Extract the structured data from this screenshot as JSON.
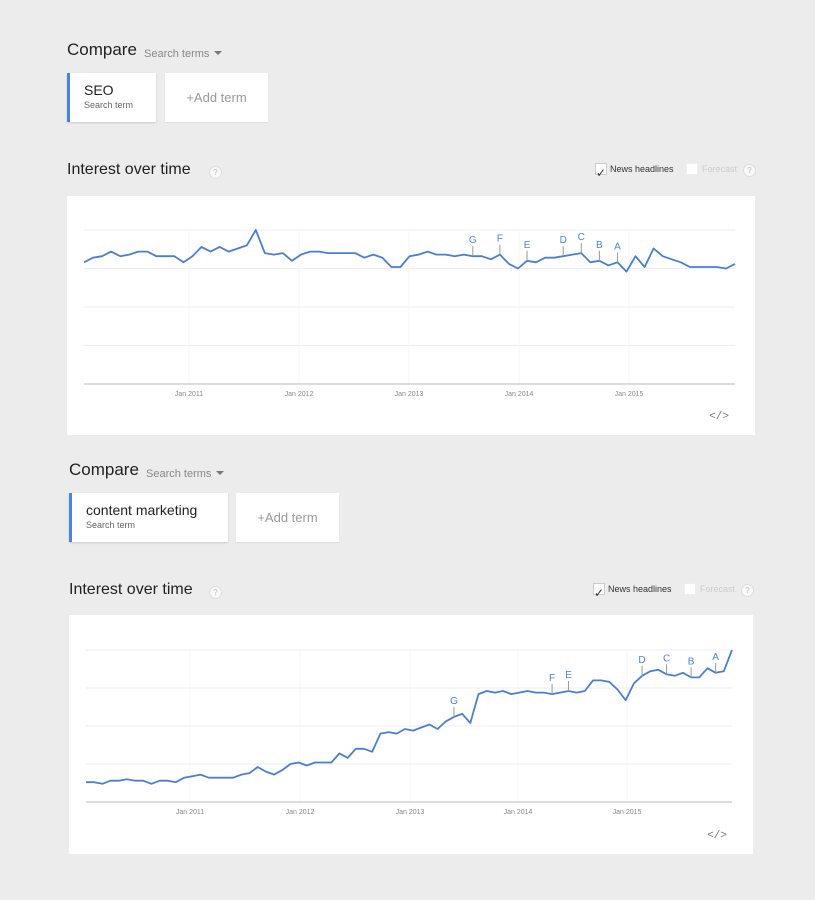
{
  "sections": [
    {
      "compare": {
        "title": "Compare",
        "mode": "Search terms"
      },
      "term": {
        "name": "SEO",
        "type": "Search term"
      },
      "add_term": "+Add term",
      "interest": {
        "title": "Interest over time",
        "help": "?"
      },
      "options": {
        "news_headlines": "News headlines",
        "news_checked": true,
        "forecast": "Forecast",
        "forecast_checked": false
      },
      "embed_icon": "</>"
    },
    {
      "compare": {
        "title": "Compare",
        "mode": "Search terms"
      },
      "term": {
        "name": "content marketing",
        "type": "Search term"
      },
      "add_term": "+Add term",
      "interest": {
        "title": "Interest over time",
        "help": "?"
      },
      "options": {
        "news_headlines": "News headlines",
        "news_checked": true,
        "forecast": "Forecast",
        "forecast_checked": false
      },
      "embed_icon": "</>"
    }
  ],
  "colors": {
    "line": "#4a7fd0",
    "accent": "#4a86d8",
    "grid": "#eeeeee",
    "axis": "#bbbbbb"
  },
  "chart_data": [
    {
      "type": "line",
      "title": "Interest over time",
      "series": [
        {
          "name": "SEO",
          "values": [
            79,
            82,
            83,
            86,
            83,
            84,
            86,
            86,
            83,
            83,
            83,
            79,
            83,
            89,
            86,
            89,
            86,
            88,
            90,
            100,
            85,
            84,
            85,
            80,
            84,
            86,
            86,
            85,
            85,
            85,
            85,
            82,
            84,
            82,
            76,
            76,
            83,
            84,
            86,
            84,
            84,
            83,
            84,
            83,
            83,
            81,
            84,
            78,
            75,
            80,
            79,
            82,
            82,
            83,
            84,
            85,
            79,
            80,
            77,
            79,
            73,
            83,
            76,
            88,
            83,
            81,
            79,
            76,
            76,
            76,
            76,
            75,
            78
          ]
        }
      ],
      "x_ticks": [
        "Jan 2011",
        "Jan 2012",
        "Jan 2013",
        "Jan 2014",
        "Jan 2015"
      ],
      "ylim": [
        0,
        100
      ],
      "grid": true,
      "annotations": [
        {
          "label": "G",
          "index": 43
        },
        {
          "label": "F",
          "index": 46
        },
        {
          "label": "E",
          "index": 49
        },
        {
          "label": "D",
          "index": 53
        },
        {
          "label": "C",
          "index": 55
        },
        {
          "label": "B",
          "index": 57
        },
        {
          "label": "A",
          "index": 59
        }
      ]
    },
    {
      "type": "line",
      "title": "Interest over time",
      "series": [
        {
          "name": "content marketing",
          "values": [
            13,
            13,
            12,
            14,
            14,
            15,
            14,
            14,
            12,
            14,
            14,
            13,
            16,
            17,
            18,
            16,
            16,
            16,
            16,
            18,
            19,
            23,
            20,
            18,
            21,
            25,
            26,
            24,
            26,
            26,
            26,
            32,
            29,
            35,
            35,
            33,
            45,
            46,
            45,
            48,
            47,
            49,
            51,
            48,
            53,
            56,
            58,
            52,
            71,
            73,
            72,
            73,
            71,
            72,
            73,
            72,
            72,
            71,
            72,
            73,
            72,
            73,
            80,
            80,
            79,
            74,
            67,
            78,
            83,
            86,
            87,
            84,
            83,
            85,
            82,
            82,
            88,
            85,
            86,
            100
          ]
        }
      ],
      "x_ticks": [
        "Jan 2011",
        "Jan 2012",
        "Jan 2013",
        "Jan 2014",
        "Jan 2015"
      ],
      "ylim": [
        0,
        100
      ],
      "grid": true,
      "annotations": [
        {
          "label": "G",
          "index": 45
        },
        {
          "label": "F",
          "index": 57
        },
        {
          "label": "E",
          "index": 59
        },
        {
          "label": "D",
          "index": 68
        },
        {
          "label": "C",
          "index": 71
        },
        {
          "label": "B",
          "index": 74
        },
        {
          "label": "A",
          "index": 77
        }
      ]
    }
  ]
}
